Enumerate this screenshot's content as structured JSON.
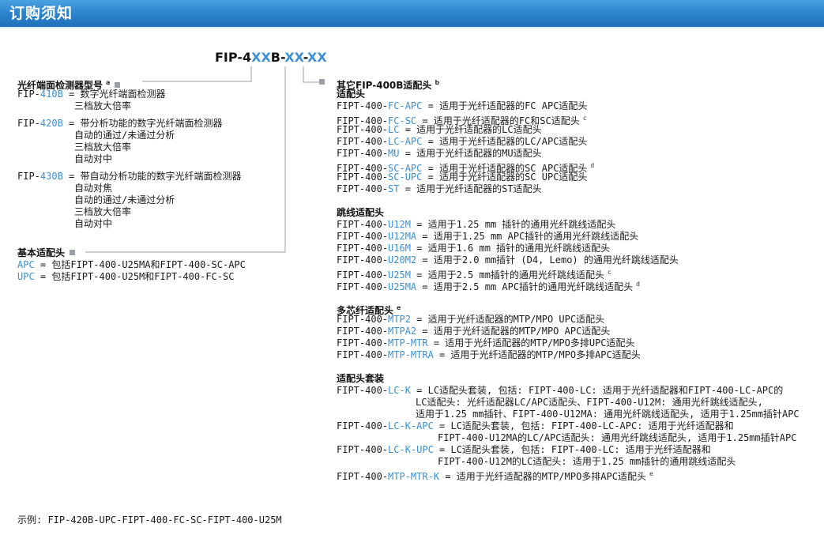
{
  "banner": {
    "title": "订购须知"
  },
  "model_code": {
    "parts": [
      {
        "text": "FIP-4",
        "hl": false
      },
      {
        "text": "XX",
        "hl": true
      },
      {
        "text": "B-",
        "hl": false
      },
      {
        "text": "XX",
        "hl": true
      },
      {
        "text": "-",
        "hl": false
      },
      {
        "text": "XX",
        "hl": true
      }
    ]
  },
  "left": {
    "inspector": {
      "heading": "光纤端面检测器型号",
      "note": "a",
      "items": [
        {
          "prefix": "FIP-",
          "code": "410B",
          "lines": [
            "= 数字光纤端面检测器",
            "三档放大倍率"
          ]
        },
        {
          "prefix": "FIP-",
          "code": "420B",
          "lines": [
            "= 带分析功能的数字光纤端面检测器",
            "自动的通过/未通过分析",
            "三档放大倍率",
            "自动对中"
          ]
        },
        {
          "prefix": "FIP-",
          "code": "430B",
          "lines": [
            "= 带自动分析功能的数字光纤端面检测器",
            "自动对焦",
            "自动的通过/未通过分析",
            "三档放大倍率",
            "自动对中"
          ]
        }
      ]
    },
    "basic": {
      "heading": "基本适配头",
      "items": [
        {
          "code": "APC",
          "text": " = 包括FIPT-400-U25MA和FIPT-400-SC-APC"
        },
        {
          "code": "UPC",
          "text": " = 包括FIPT-400-U25M和FIPT-400-FC-SC"
        }
      ]
    }
  },
  "right": {
    "heading": "其它FIP-400B适配头",
    "note": "b",
    "groups": [
      {
        "title": "适配头",
        "title_note": "",
        "items": [
          {
            "prefix": "FIPT-400-",
            "code": "FC-APC",
            "text": " = 适用于光纤适配器的FC APC适配头",
            "note": ""
          },
          {
            "prefix": "FIPT-400-",
            "code": "FC-SC",
            "text": " = 适用于光纤适配器的FC和SC适配头",
            "note": "c"
          },
          {
            "prefix": "FIPT-400-",
            "code": "LC",
            "text": " = 适用于光纤适配器的LC适配头",
            "note": ""
          },
          {
            "prefix": "FIPT-400-",
            "code": "LC-APC",
            "text": " = 适用于光纤适配器的LC/APC适配头",
            "note": ""
          },
          {
            "prefix": "FIPT-400-",
            "code": "MU",
            "text": " = 适用于光纤适配器的MU适配头",
            "note": ""
          },
          {
            "prefix": "FIPT-400-",
            "code": "SC-APC",
            "text": " = 适用于光纤适配器的SC APC适配头",
            "note": "d"
          },
          {
            "prefix": "FIPT-400-",
            "code": "SC-UPC",
            "text": " = 适用于光纤适配器的SC UPC适配头",
            "note": ""
          },
          {
            "prefix": "FIPT-400-",
            "code": "ST",
            "text": " = 适用于光纤适配器的ST适配头",
            "note": ""
          }
        ]
      },
      {
        "title": "跳线适配头",
        "title_note": "",
        "items": [
          {
            "prefix": "FIPT-400-",
            "code": "U12M",
            "text": " = 适用于1.25 mm 插针的通用光纤跳线适配头",
            "note": ""
          },
          {
            "prefix": "FIPT-400-",
            "code": "U12MA",
            "text": " = 适用于1.25 mm APC插针的通用光纤跳线适配头",
            "note": ""
          },
          {
            "prefix": "FIPT-400-",
            "code": "U16M",
            "text": " = 适用于1.6 mm 插针的通用光纤跳线适配头",
            "note": ""
          },
          {
            "prefix": "FIPT-400-",
            "code": "U20M2",
            "text": " = 适用于2.0 mm插针 (D4, Lemo) 的通用光纤跳线适配头",
            "note": ""
          },
          {
            "prefix": "FIPT-400-",
            "code": "U25M",
            "text": " = 适用于2.5 mm插针的通用光纤跳线适配头",
            "note": "c"
          },
          {
            "prefix": "FIPT-400-",
            "code": "U25MA",
            "text": " = 适用于2.5 mm APC插针的通用光纤跳线适配头",
            "note": "d"
          }
        ]
      },
      {
        "title": "多芯纤适配头",
        "title_note": "e",
        "items": [
          {
            "prefix": "FIPT-400-",
            "code": "MTP2",
            "text": " = 适用于光纤适配器的MTP/MPO UPC适配头",
            "note": ""
          },
          {
            "prefix": "FIPT-400-",
            "code": "MTPA2",
            "text": " = 适用于光纤适配器的MTP/MPO APC适配头",
            "note": ""
          },
          {
            "prefix": "FIPT-400-",
            "code": "MTP-MTR",
            "text": " = 适用于光纤适配器的MTP/MPO多排UPC适配头",
            "note": ""
          },
          {
            "prefix": "FIPT-400-",
            "code": "MTP-MTRA",
            "text": " = 适用于光纤适配器的MTP/MPO多排APC适配头",
            "note": ""
          }
        ]
      }
    ],
    "kits": {
      "title": "适配头套装",
      "items": [
        {
          "prefix": "FIPT-400-",
          "code": "LC-K",
          "first": " = LC适配头套装, 包括: FIPT-400-LC: 适用于光纤适配器和FIPT-400-LC-APC的",
          "cont": [
            "LC适配头: 光纤适配器LC/APC适配头、FIPT-400-U12M: 通用光纤跳线适配头,",
            " 适用于1.25 mm插针、FIPT-400-U12MA: 通用光纤跳线适配头, 适用于1.25mm插针APC"
          ],
          "ind": "ind2",
          "note": ""
        },
        {
          "prefix": "FIPT-400-",
          "code": "LC-K-APC",
          "first": " = LC适配头套装, 包括: FIPT-400-LC-APC: 适用于光纤适配器和",
          "cont": [
            "FIPT-400-U12MA的LC/APC适配头: 通用光纤跳线适配头, 适用于1.25mm插针APC"
          ],
          "ind": "ind3",
          "note": ""
        },
        {
          "prefix": "FIPT-400-",
          "code": "LC-K-UPC",
          "first": " = LC适配头套装, 包括: FIPT-400-LC: 适用于光纤适配器和",
          "cont": [
            "FIPT-400-U12M的LC适配头: 适用于1.25 mm插针的通用跳线适配头"
          ],
          "ind": "ind3",
          "note": ""
        },
        {
          "prefix": "FIPT-400-",
          "code": "MTP-MTR-K",
          "first": " = 适用于光纤适配器的MTP/MPO多排APC适配头",
          "cont": [],
          "ind": "ind2",
          "note": "e"
        }
      ]
    }
  },
  "example": {
    "text": "示例: FIP-420B-UPC-FIPT-400-FC-SC-FIPT-400-U25M"
  },
  "colors": {
    "banner": "#2f86cf",
    "highlight": "#3b8fd4",
    "connector": "#9aa0a6"
  }
}
